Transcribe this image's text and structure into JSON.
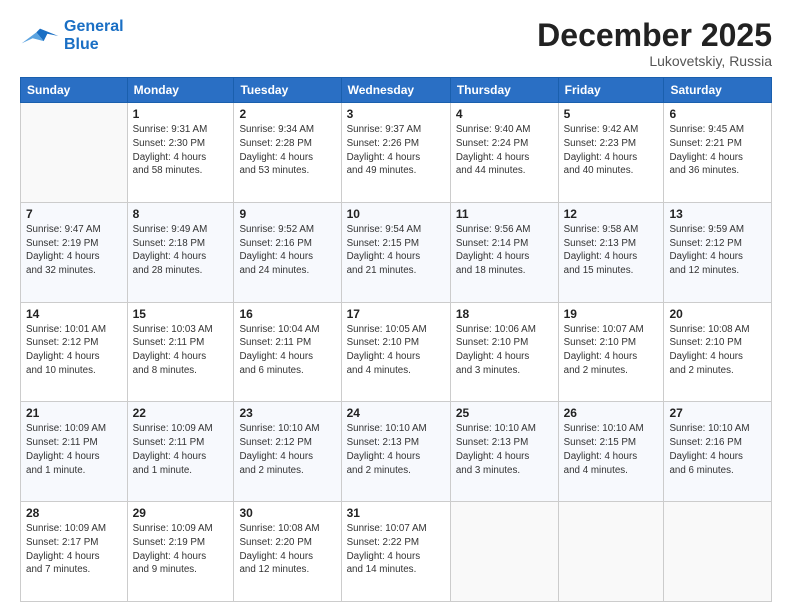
{
  "header": {
    "logo_line1": "General",
    "logo_line2": "Blue",
    "month_title": "December 2025",
    "location": "Lukovetskiy, Russia"
  },
  "weekdays": [
    "Sunday",
    "Monday",
    "Tuesday",
    "Wednesday",
    "Thursday",
    "Friday",
    "Saturday"
  ],
  "weeks": [
    [
      {
        "day": "",
        "info": ""
      },
      {
        "day": "1",
        "info": "Sunrise: 9:31 AM\nSunset: 2:30 PM\nDaylight: 4 hours\nand 58 minutes."
      },
      {
        "day": "2",
        "info": "Sunrise: 9:34 AM\nSunset: 2:28 PM\nDaylight: 4 hours\nand 53 minutes."
      },
      {
        "day": "3",
        "info": "Sunrise: 9:37 AM\nSunset: 2:26 PM\nDaylight: 4 hours\nand 49 minutes."
      },
      {
        "day": "4",
        "info": "Sunrise: 9:40 AM\nSunset: 2:24 PM\nDaylight: 4 hours\nand 44 minutes."
      },
      {
        "day": "5",
        "info": "Sunrise: 9:42 AM\nSunset: 2:23 PM\nDaylight: 4 hours\nand 40 minutes."
      },
      {
        "day": "6",
        "info": "Sunrise: 9:45 AM\nSunset: 2:21 PM\nDaylight: 4 hours\nand 36 minutes."
      }
    ],
    [
      {
        "day": "7",
        "info": "Sunrise: 9:47 AM\nSunset: 2:19 PM\nDaylight: 4 hours\nand 32 minutes."
      },
      {
        "day": "8",
        "info": "Sunrise: 9:49 AM\nSunset: 2:18 PM\nDaylight: 4 hours\nand 28 minutes."
      },
      {
        "day": "9",
        "info": "Sunrise: 9:52 AM\nSunset: 2:16 PM\nDaylight: 4 hours\nand 24 minutes."
      },
      {
        "day": "10",
        "info": "Sunrise: 9:54 AM\nSunset: 2:15 PM\nDaylight: 4 hours\nand 21 minutes."
      },
      {
        "day": "11",
        "info": "Sunrise: 9:56 AM\nSunset: 2:14 PM\nDaylight: 4 hours\nand 18 minutes."
      },
      {
        "day": "12",
        "info": "Sunrise: 9:58 AM\nSunset: 2:13 PM\nDaylight: 4 hours\nand 15 minutes."
      },
      {
        "day": "13",
        "info": "Sunrise: 9:59 AM\nSunset: 2:12 PM\nDaylight: 4 hours\nand 12 minutes."
      }
    ],
    [
      {
        "day": "14",
        "info": "Sunrise: 10:01 AM\nSunset: 2:12 PM\nDaylight: 4 hours\nand 10 minutes."
      },
      {
        "day": "15",
        "info": "Sunrise: 10:03 AM\nSunset: 2:11 PM\nDaylight: 4 hours\nand 8 minutes."
      },
      {
        "day": "16",
        "info": "Sunrise: 10:04 AM\nSunset: 2:11 PM\nDaylight: 4 hours\nand 6 minutes."
      },
      {
        "day": "17",
        "info": "Sunrise: 10:05 AM\nSunset: 2:10 PM\nDaylight: 4 hours\nand 4 minutes."
      },
      {
        "day": "18",
        "info": "Sunrise: 10:06 AM\nSunset: 2:10 PM\nDaylight: 4 hours\nand 3 minutes."
      },
      {
        "day": "19",
        "info": "Sunrise: 10:07 AM\nSunset: 2:10 PM\nDaylight: 4 hours\nand 2 minutes."
      },
      {
        "day": "20",
        "info": "Sunrise: 10:08 AM\nSunset: 2:10 PM\nDaylight: 4 hours\nand 2 minutes."
      }
    ],
    [
      {
        "day": "21",
        "info": "Sunrise: 10:09 AM\nSunset: 2:11 PM\nDaylight: 4 hours\nand 1 minute."
      },
      {
        "day": "22",
        "info": "Sunrise: 10:09 AM\nSunset: 2:11 PM\nDaylight: 4 hours\nand 1 minute."
      },
      {
        "day": "23",
        "info": "Sunrise: 10:10 AM\nSunset: 2:12 PM\nDaylight: 4 hours\nand 2 minutes."
      },
      {
        "day": "24",
        "info": "Sunrise: 10:10 AM\nSunset: 2:13 PM\nDaylight: 4 hours\nand 2 minutes."
      },
      {
        "day": "25",
        "info": "Sunrise: 10:10 AM\nSunset: 2:13 PM\nDaylight: 4 hours\nand 3 minutes."
      },
      {
        "day": "26",
        "info": "Sunrise: 10:10 AM\nSunset: 2:15 PM\nDaylight: 4 hours\nand 4 minutes."
      },
      {
        "day": "27",
        "info": "Sunrise: 10:10 AM\nSunset: 2:16 PM\nDaylight: 4 hours\nand 6 minutes."
      }
    ],
    [
      {
        "day": "28",
        "info": "Sunrise: 10:09 AM\nSunset: 2:17 PM\nDaylight: 4 hours\nand 7 minutes."
      },
      {
        "day": "29",
        "info": "Sunrise: 10:09 AM\nSunset: 2:19 PM\nDaylight: 4 hours\nand 9 minutes."
      },
      {
        "day": "30",
        "info": "Sunrise: 10:08 AM\nSunset: 2:20 PM\nDaylight: 4 hours\nand 12 minutes."
      },
      {
        "day": "31",
        "info": "Sunrise: 10:07 AM\nSunset: 2:22 PM\nDaylight: 4 hours\nand 14 minutes."
      },
      {
        "day": "",
        "info": ""
      },
      {
        "day": "",
        "info": ""
      },
      {
        "day": "",
        "info": ""
      }
    ]
  ]
}
